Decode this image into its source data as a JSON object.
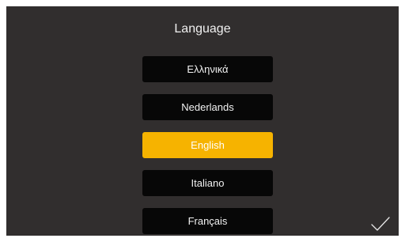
{
  "screen": {
    "title": "Language"
  },
  "languages": {
    "items": [
      {
        "label": "Ελληνικά",
        "selected": false
      },
      {
        "label": "Nederlands",
        "selected": false
      },
      {
        "label": "English",
        "selected": true
      },
      {
        "label": "Italiano",
        "selected": false
      },
      {
        "label": "Français",
        "selected": false
      }
    ]
  },
  "icons": {
    "confirm": "checkmark-icon"
  },
  "colors": {
    "background": "#312e2e",
    "button": "#070707",
    "selected": "#f6b300",
    "text": "#f2f2f2"
  }
}
